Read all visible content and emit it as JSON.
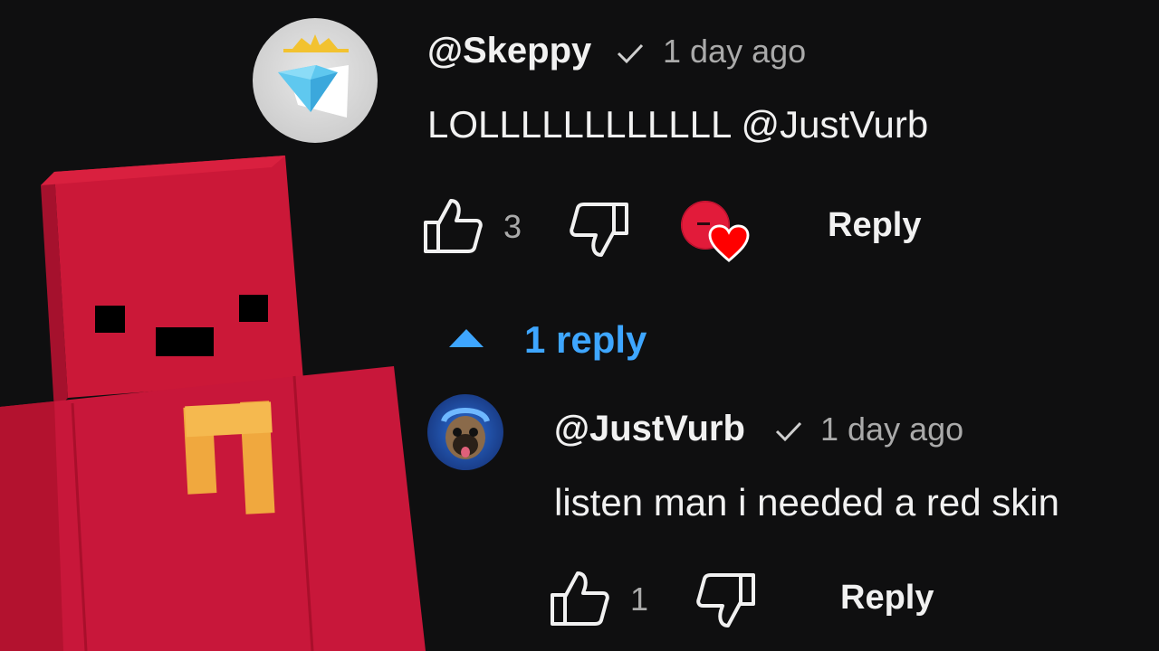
{
  "comment": {
    "username": "@Skeppy",
    "verified_icon": "checkmark-icon",
    "time": "1 day ago",
    "text": "LOLLLLLLLLLLLL @JustVurb",
    "like_count": "3",
    "reply_label": "Reply",
    "heart_icon": "creator-heart-icon"
  },
  "replies_toggle": {
    "label": "1 reply",
    "icon": "caret-up-icon"
  },
  "reply": {
    "username": "@JustVurb",
    "verified_icon": "checkmark-icon",
    "time": "1 day ago",
    "text": "listen man i needed a red skin",
    "like_count": "1",
    "reply_label": "Reply"
  },
  "colors": {
    "background": "#0f0f10",
    "link_blue": "#3ea6ff",
    "muted": "#aaaaaa",
    "heart_red": "#ff0000",
    "skin_red": "#c8173a"
  }
}
